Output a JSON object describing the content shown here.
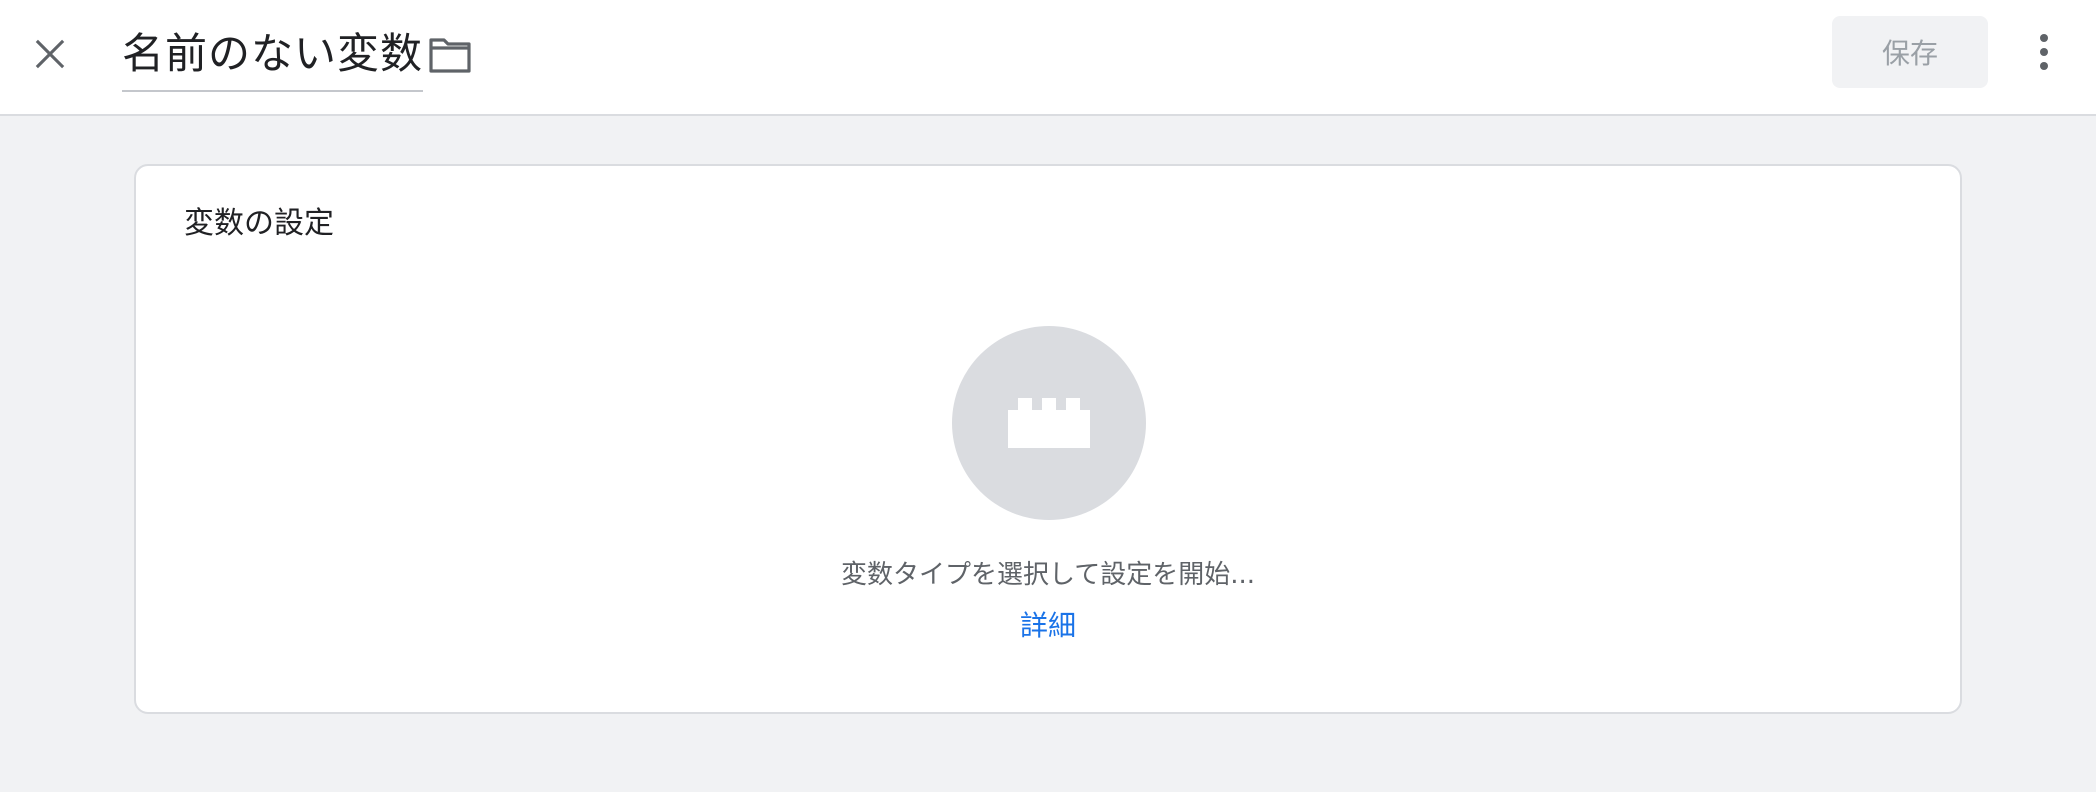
{
  "header": {
    "title": "名前のない変数",
    "close_icon": "close-icon",
    "folder_icon": "folder-icon",
    "save_label": "保存",
    "more_icon": "more-vert-icon"
  },
  "config_card": {
    "title": "変数の設定",
    "picker_icon": "block-icon",
    "hint": "変数タイプを選択して設定を開始...",
    "learn_more": "詳細"
  },
  "colors": {
    "link": "#1a73e8",
    "page_bg": "#f1f2f4",
    "picker_bg": "#dadce0",
    "save_disabled_text": "#9aa0a6"
  }
}
